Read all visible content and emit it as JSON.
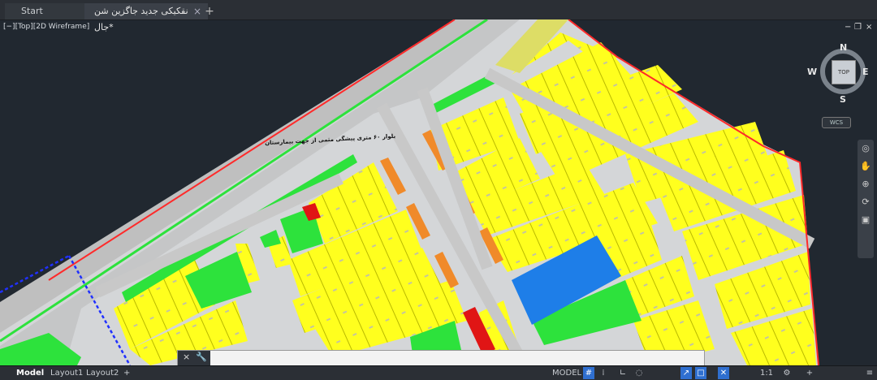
{
  "tabs": {
    "start": "Start",
    "file": "نقکیکی جدید جاگزین شن جال*"
  },
  "viewport": {
    "label": "[−][Top][2D Wireframe]"
  },
  "drawing": {
    "road_text": "بلوار ۶۰ متری پیشگی مثمی  از جهت بیمارستان"
  },
  "viewcube": {
    "top": "TOP",
    "n": "N",
    "s": "S",
    "e": "E",
    "w": "W",
    "wcs": "WCS"
  },
  "layouts": {
    "model": "Model",
    "layout1": "Layout1",
    "layout2": "Layout2"
  },
  "status": {
    "model": "MODEL",
    "scale": "1:1"
  },
  "colors": {
    "lot": "#ffff1e",
    "green": "#2de23c",
    "road": "#c8c8c8",
    "blue": "#1e7ee8",
    "orange": "#f08a2a",
    "red": "#e01515",
    "bg": "#212830"
  },
  "icons": [
    "grid-icon",
    "snap-icon",
    "ortho-icon",
    "polar-icon",
    "osnap-icon",
    "annotation-icon",
    "gear-icon",
    "plus-icon",
    "menu-icon"
  ]
}
